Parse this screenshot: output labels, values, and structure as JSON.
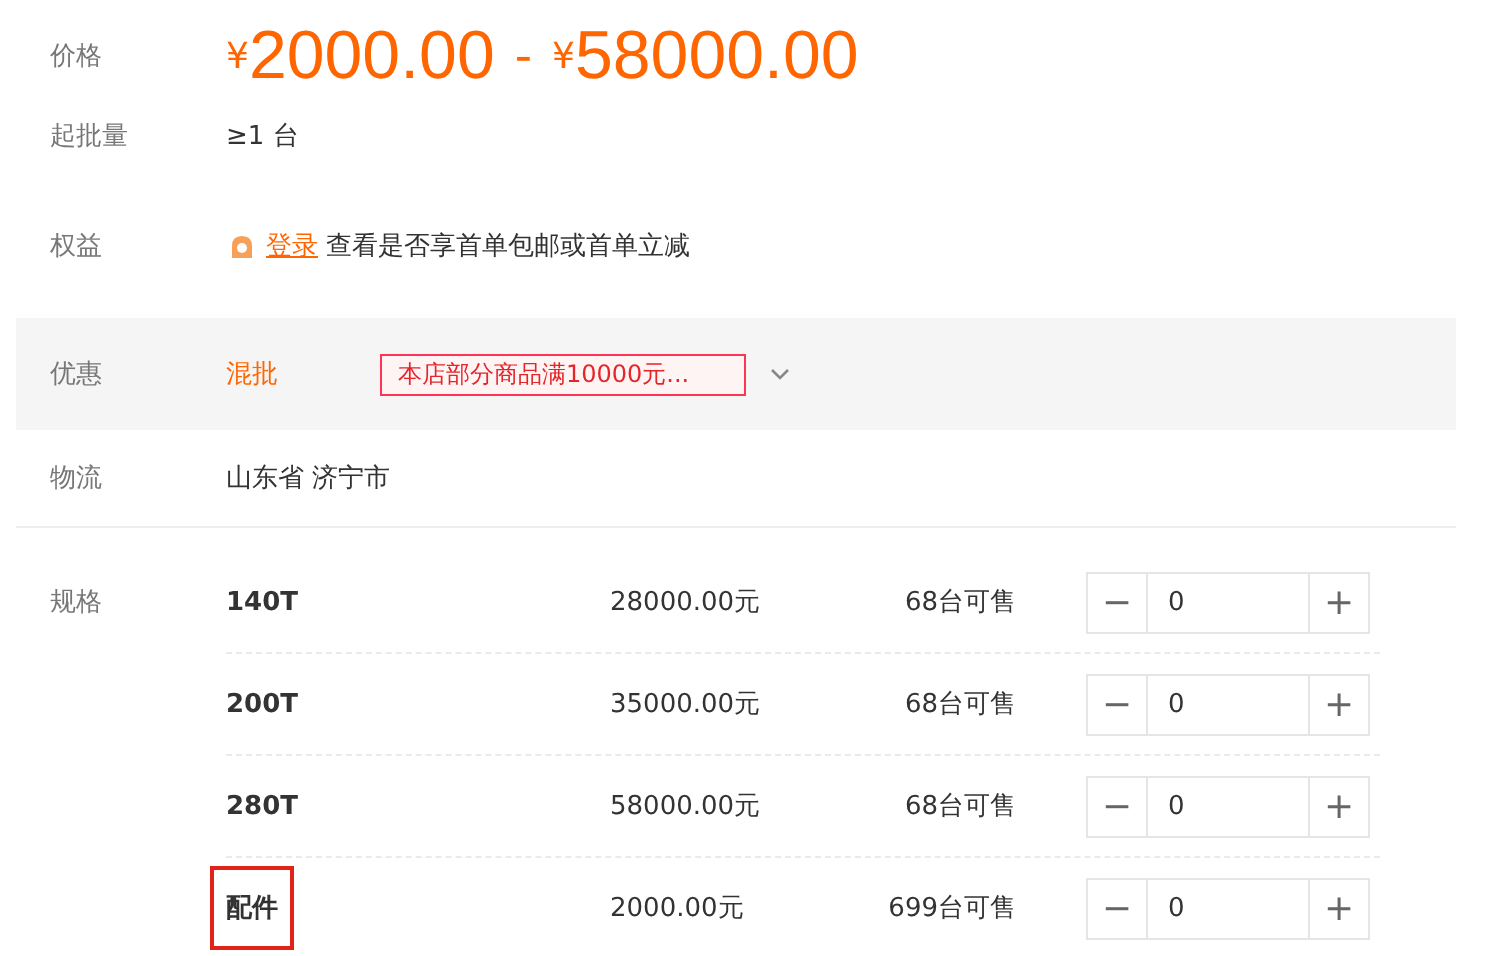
{
  "price": {
    "label": "价格",
    "low_currency": "¥",
    "low": "2000.00",
    "separator": "-",
    "high_currency": "¥",
    "high": "58000.00"
  },
  "min_order": {
    "label": "起批量",
    "value": "≥1 台"
  },
  "benefits": {
    "label": "权益",
    "login_link": "登录",
    "text": "查看是否享首单包邮或首单立减"
  },
  "discount": {
    "label": "优惠",
    "type": "混批",
    "coupon": "本店部分商品满10000元..."
  },
  "logistics": {
    "label": "物流",
    "value": "山东省 济宁市"
  },
  "specs": {
    "label": "规格",
    "rows": [
      {
        "name": "140T",
        "price": "28000.00元",
        "stock": "68台可售",
        "minus": "−",
        "quantity": "0",
        "plus": "+",
        "highlighted": false
      },
      {
        "name": "200T",
        "price": "35000.00元",
        "stock": "68台可售",
        "minus": "−",
        "quantity": "0",
        "plus": "+",
        "highlighted": false
      },
      {
        "name": "280T",
        "price": "58000.00元",
        "stock": "68台可售",
        "minus": "−",
        "quantity": "0",
        "plus": "+",
        "highlighted": false
      },
      {
        "name": "配件",
        "price": "2000.00元",
        "stock": "699台可售",
        "minus": "−",
        "quantity": "0",
        "plus": "+",
        "highlighted": true
      }
    ]
  }
}
